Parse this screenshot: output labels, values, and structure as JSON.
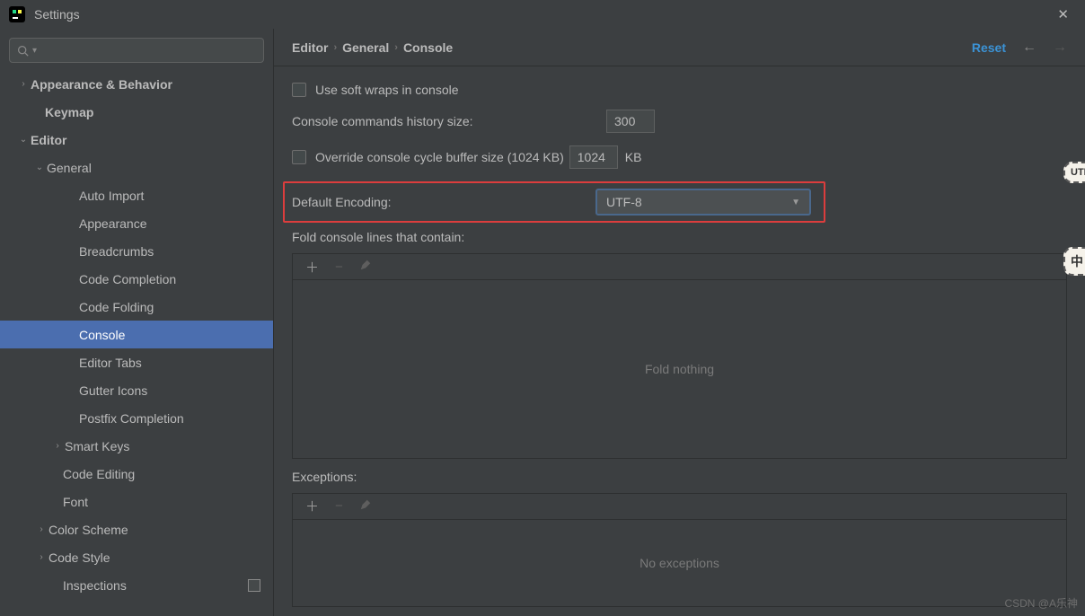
{
  "window": {
    "title": "Settings"
  },
  "sidebar": {
    "items": [
      {
        "label": "Appearance & Behavior",
        "indent": 18,
        "chevron": "right",
        "bold": true
      },
      {
        "label": "Keymap",
        "indent": 34,
        "chevron": "",
        "bold": true
      },
      {
        "label": "Editor",
        "indent": 18,
        "chevron": "down",
        "bold": true
      },
      {
        "label": "General",
        "indent": 36,
        "chevron": "down",
        "bold": false
      },
      {
        "label": "Auto Import",
        "indent": 72,
        "chevron": "",
        "bold": false
      },
      {
        "label": "Appearance",
        "indent": 72,
        "chevron": "",
        "bold": false
      },
      {
        "label": "Breadcrumbs",
        "indent": 72,
        "chevron": "",
        "bold": false
      },
      {
        "label": "Code Completion",
        "indent": 72,
        "chevron": "",
        "bold": false
      },
      {
        "label": "Code Folding",
        "indent": 72,
        "chevron": "",
        "bold": false
      },
      {
        "label": "Console",
        "indent": 72,
        "chevron": "",
        "bold": false,
        "selected": true
      },
      {
        "label": "Editor Tabs",
        "indent": 72,
        "chevron": "",
        "bold": false
      },
      {
        "label": "Gutter Icons",
        "indent": 72,
        "chevron": "",
        "bold": false
      },
      {
        "label": "Postfix Completion",
        "indent": 72,
        "chevron": "",
        "bold": false
      },
      {
        "label": "Smart Keys",
        "indent": 56,
        "chevron": "right",
        "bold": false
      },
      {
        "label": "Code Editing",
        "indent": 54,
        "chevron": "",
        "bold": false
      },
      {
        "label": "Font",
        "indent": 54,
        "chevron": "",
        "bold": false
      },
      {
        "label": "Color Scheme",
        "indent": 38,
        "chevron": "right",
        "bold": false
      },
      {
        "label": "Code Style",
        "indent": 38,
        "chevron": "right",
        "bold": false
      },
      {
        "label": "Inspections",
        "indent": 54,
        "chevron": "",
        "bold": false,
        "overlay": true
      }
    ]
  },
  "breadcrumb": {
    "a": "Editor",
    "b": "General",
    "c": "Console"
  },
  "header": {
    "reset": "Reset"
  },
  "form": {
    "soft_wraps": "Use soft wraps in console",
    "history_label": "Console commands history size:",
    "history_value": "300",
    "override_label": "Override console cycle buffer size (1024 KB)",
    "override_value": "1024",
    "override_unit": "KB",
    "encoding_label": "Default Encoding:",
    "encoding_value": "UTF-8",
    "fold_label": "Fold console lines that contain:",
    "fold_placeholder": "Fold nothing",
    "exceptions_label": "Exceptions:",
    "exceptions_placeholder": "No exceptions"
  },
  "watermark": "CSDN @A乐神",
  "floaters": {
    "top": "UTH",
    "bottom": "中"
  }
}
